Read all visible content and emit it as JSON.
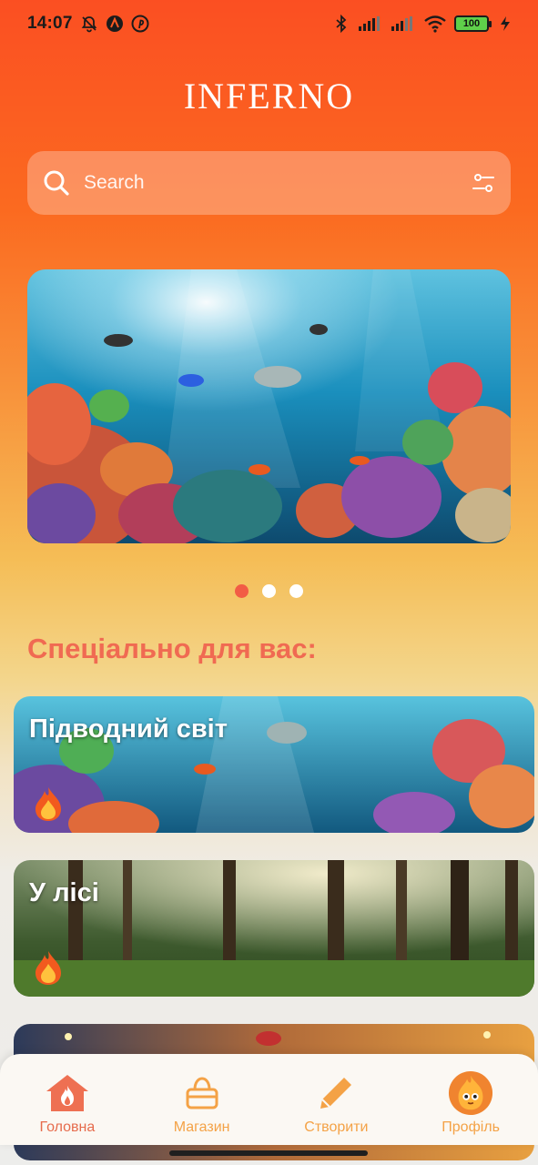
{
  "status_bar": {
    "time": "14:07",
    "battery": "100",
    "left_icons": [
      "bell-off-icon",
      "app-a-icon",
      "pinterest-icon"
    ],
    "right_icons": [
      "bluetooth-icon",
      "signal-icon",
      "signal-icon",
      "wifi-icon",
      "battery-icon",
      "charging-icon"
    ]
  },
  "header": {
    "title": "INFERNO"
  },
  "search": {
    "placeholder": "Search"
  },
  "carousel": {
    "slides": 3,
    "active_index": 0
  },
  "section": {
    "title": "Спеціально для вас:"
  },
  "cards": [
    {
      "title": "Підводний світ",
      "icon": "flame-icon"
    },
    {
      "title": "У лісі",
      "icon": "flame-icon"
    },
    {
      "title": "",
      "icon": "flame-icon"
    }
  ],
  "nav": {
    "items": [
      {
        "label": "Головна",
        "icon": "home-icon",
        "active": true
      },
      {
        "label": "Магазин",
        "icon": "basket-icon",
        "active": false
      },
      {
        "label": "Створити",
        "icon": "pencil-icon",
        "active": false
      },
      {
        "label": "Профіль",
        "icon": "avatar-icon",
        "active": false
      }
    ]
  },
  "colors": {
    "accent": "#f25c45",
    "section_title": "#f06a52",
    "nav_inactive": "#f4a246",
    "gradient_top": "#fb4f22",
    "gradient_bottom": "#ededeb"
  }
}
